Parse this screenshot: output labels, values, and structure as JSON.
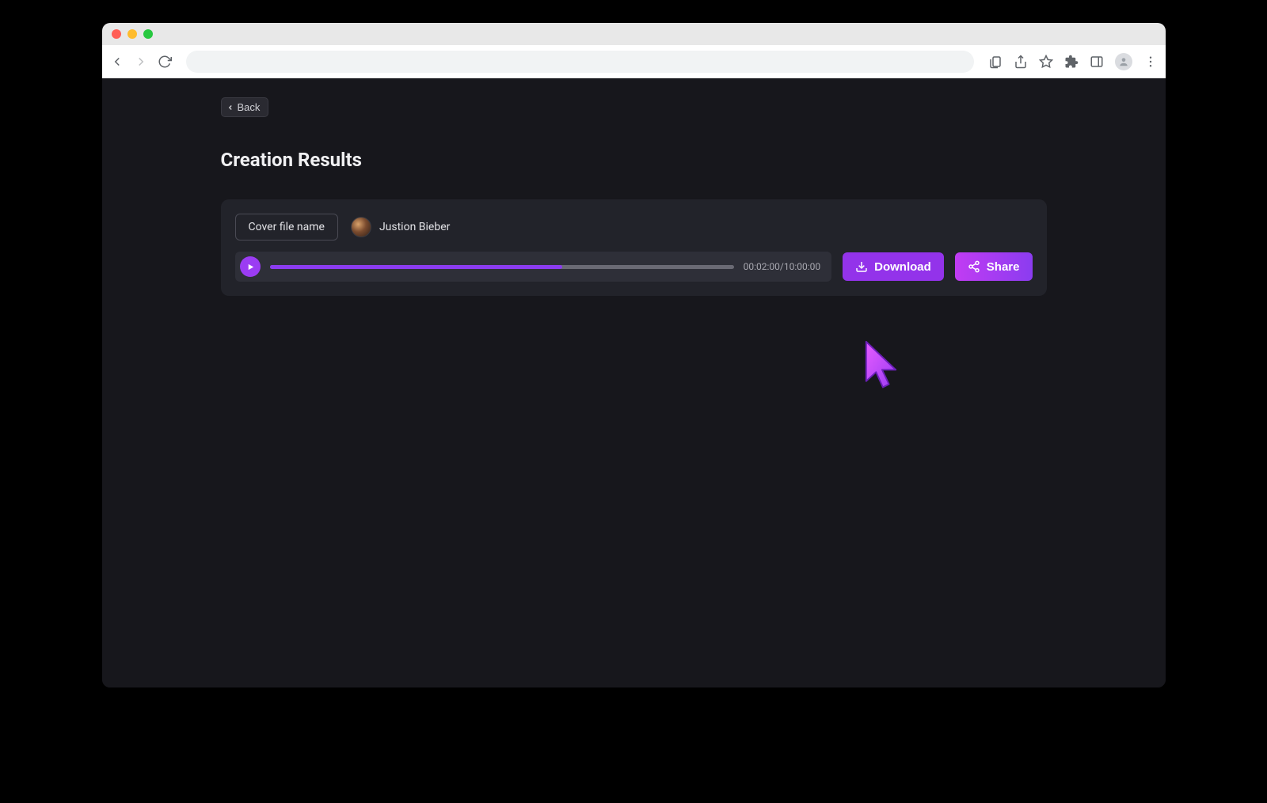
{
  "nav": {
    "back_label": "Back"
  },
  "page": {
    "title": "Creation Results"
  },
  "result": {
    "file_name": "Cover file name",
    "artist_name": "Justion Bieber",
    "time_current": "00:02:00",
    "time_total": "10:00:00",
    "time_display": "00:02:00/10:00:00",
    "progress_percent": 63
  },
  "actions": {
    "download_label": "Download",
    "share_label": "Share"
  },
  "colors": {
    "accent": "#9333ea",
    "accent_gradient_start": "#c13cf3",
    "accent_gradient_end": "#8b3cf0",
    "page_bg": "#17171c",
    "card_bg": "#22232a"
  }
}
